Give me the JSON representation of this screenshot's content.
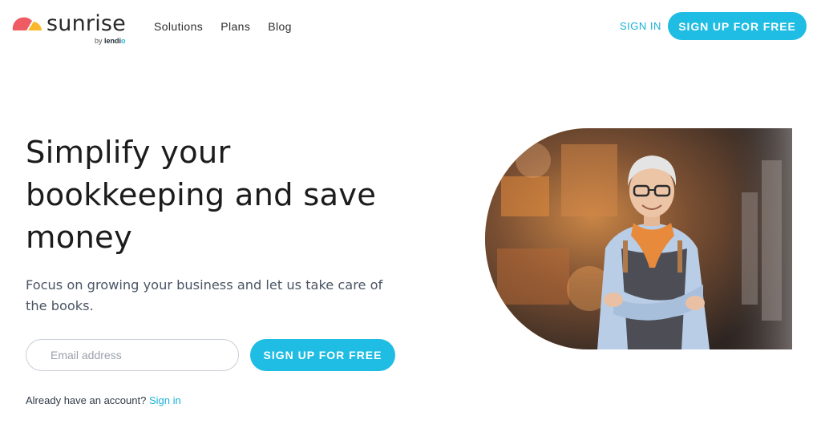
{
  "header": {
    "logo_text": "sunrise",
    "logo_by": "by",
    "logo_brand_main": "lendi",
    "logo_brand_end": "o",
    "nav": [
      "Solutions",
      "Plans",
      "Blog"
    ],
    "sign_in": "SIGN IN",
    "signup_button": "SIGN UP FOR FREE"
  },
  "hero": {
    "headline_lines": [
      "Simplify your",
      "bookkeeping and save",
      "money"
    ],
    "subhead_lines": [
      "Focus on growing your business and let us take care of",
      "the books."
    ],
    "email_placeholder": "Email address",
    "signup_button": "SIGN UP FOR FREE",
    "already_text": "Already have an account?",
    "already_link": "Sign in"
  },
  "colors": {
    "accent": "#1fbde3",
    "logo_red": "#ef5b63",
    "logo_yellow": "#f9b729",
    "image_orange": "#f79a3a"
  },
  "icons": {
    "logo_mark": "sunrise-logo-icon",
    "hero_photo": "woman-shop-owner-photo"
  }
}
